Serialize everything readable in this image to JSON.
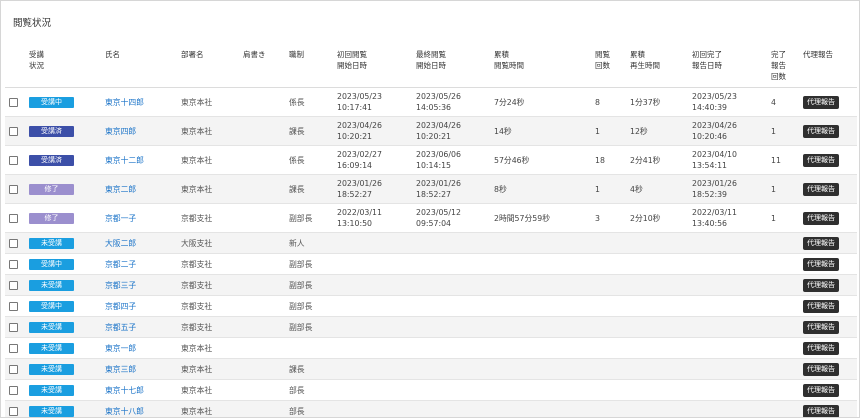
{
  "page": {
    "title": "閲覧状況"
  },
  "table": {
    "headers": {
      "status": "受講\n状況",
      "name": "氏名",
      "dept": "部署名",
      "memo": "肩書き",
      "position": "職制",
      "first_view": "初回閲覧\n開始日時",
      "last_view": "最終閲覧\n開始日時",
      "total_view": "累積\n閲覧時間",
      "views": "閲覧\n回数",
      "total_play": "累積\n再生時間",
      "first_done": "初回完了\n報告日時",
      "done_count": "完了\n報告\n回数",
      "proxy": "代理報告"
    },
    "rows": [
      {
        "status": "受講中",
        "name": "東京十四郎",
        "dept": "東京本社",
        "memo": "",
        "position": "係長",
        "first_view": "2023/05/23\n10:17:41",
        "last_view": "2023/05/26\n14:05:36",
        "total_view": "7分24秒",
        "views": "8",
        "total_play": "1分37秒",
        "first_done": "2023/05/23\n14:40:39",
        "done_count": "4",
        "proxy": "代理報告"
      },
      {
        "status": "受講済",
        "name": "東京四郎",
        "dept": "東京本社",
        "memo": "",
        "position": "課長",
        "first_view": "2023/04/26\n10:20:21",
        "last_view": "2023/04/26\n10:20:21",
        "total_view": "14秒",
        "views": "1",
        "total_play": "12秒",
        "first_done": "2023/04/26\n10:20:46",
        "done_count": "1",
        "proxy": "代理報告"
      },
      {
        "status": "受講済",
        "name": "東京十二郎",
        "dept": "東京本社",
        "memo": "",
        "position": "係長",
        "first_view": "2023/02/27\n16:09:14",
        "last_view": "2023/06/06\n10:14:15",
        "total_view": "57分46秒",
        "views": "18",
        "total_play": "2分41秒",
        "first_done": "2023/04/10\n13:54:11",
        "done_count": "11",
        "proxy": "代理報告"
      },
      {
        "status": "修了",
        "name": "東京二郎",
        "dept": "東京本社",
        "memo": "",
        "position": "課長",
        "first_view": "2023/01/26\n18:52:27",
        "last_view": "2023/01/26\n18:52:27",
        "total_view": "8秒",
        "views": "1",
        "total_play": "4秒",
        "first_done": "2023/01/26\n18:52:39",
        "done_count": "1",
        "proxy": "代理報告"
      },
      {
        "status": "修了",
        "name": "京都一子",
        "dept": "京都支社",
        "memo": "",
        "position": "副部長",
        "first_view": "2022/03/11\n13:10:50",
        "last_view": "2023/05/12\n09:57:04",
        "total_view": "2時間57分59秒",
        "views": "3",
        "total_play": "2分10秒",
        "first_done": "2022/03/11\n13:40:56",
        "done_count": "1",
        "proxy": "代理報告"
      },
      {
        "status": "未受講",
        "name": "大阪二郎",
        "dept": "大阪支社",
        "memo": "",
        "position": "新人",
        "first_view": "",
        "last_view": "",
        "total_view": "",
        "views": "",
        "total_play": "",
        "first_done": "",
        "done_count": "",
        "proxy": "代理報告"
      },
      {
        "status": "受講中",
        "name": "京都二子",
        "dept": "京都支社",
        "memo": "",
        "position": "副部長",
        "first_view": "",
        "last_view": "",
        "total_view": "",
        "views": "",
        "total_play": "",
        "first_done": "",
        "done_count": "",
        "proxy": "代理報告"
      },
      {
        "status": "未受講",
        "name": "京都三子",
        "dept": "京都支社",
        "memo": "",
        "position": "副部長",
        "first_view": "",
        "last_view": "",
        "total_view": "",
        "views": "",
        "total_play": "",
        "first_done": "",
        "done_count": "",
        "proxy": "代理報告"
      },
      {
        "status": "受講中",
        "name": "京都四子",
        "dept": "京都支社",
        "memo": "",
        "position": "副部長",
        "first_view": "",
        "last_view": "",
        "total_view": "",
        "views": "",
        "total_play": "",
        "first_done": "",
        "done_count": "",
        "proxy": "代理報告"
      },
      {
        "status": "未受講",
        "name": "京都五子",
        "dept": "京都支社",
        "memo": "",
        "position": "副部長",
        "first_view": "",
        "last_view": "",
        "total_view": "",
        "views": "",
        "total_play": "",
        "first_done": "",
        "done_count": "",
        "proxy": "代理報告"
      },
      {
        "status": "未受講",
        "name": "東京一郎",
        "dept": "東京本社",
        "memo": "",
        "position": "",
        "first_view": "",
        "last_view": "",
        "total_view": "",
        "views": "",
        "total_play": "",
        "first_done": "",
        "done_count": "",
        "proxy": "代理報告"
      },
      {
        "status": "未受講",
        "name": "東京三郎",
        "dept": "東京本社",
        "memo": "",
        "position": "課長",
        "first_view": "",
        "last_view": "",
        "total_view": "",
        "views": "",
        "total_play": "",
        "first_done": "",
        "done_count": "",
        "proxy": "代理報告"
      },
      {
        "status": "未受講",
        "name": "東京十七郎",
        "dept": "東京本社",
        "memo": "",
        "position": "部長",
        "first_view": "",
        "last_view": "",
        "total_view": "",
        "views": "",
        "total_play": "",
        "first_done": "",
        "done_count": "",
        "proxy": "代理報告"
      },
      {
        "status": "未受講",
        "name": "東京十八郎",
        "dept": "東京本社",
        "memo": "",
        "position": "部長",
        "first_view": "",
        "last_view": "",
        "total_view": "",
        "views": "",
        "total_play": "",
        "first_done": "",
        "done_count": "",
        "proxy": "代理報告"
      }
    ]
  },
  "colors": {
    "受講中": "#1a9ee0",
    "受講済": "#3c4fa8",
    "修了": "#9b8fce",
    "未受講": "#1a9ee0",
    "link": "#1a73c8",
    "button": "#2f2f2f"
  }
}
